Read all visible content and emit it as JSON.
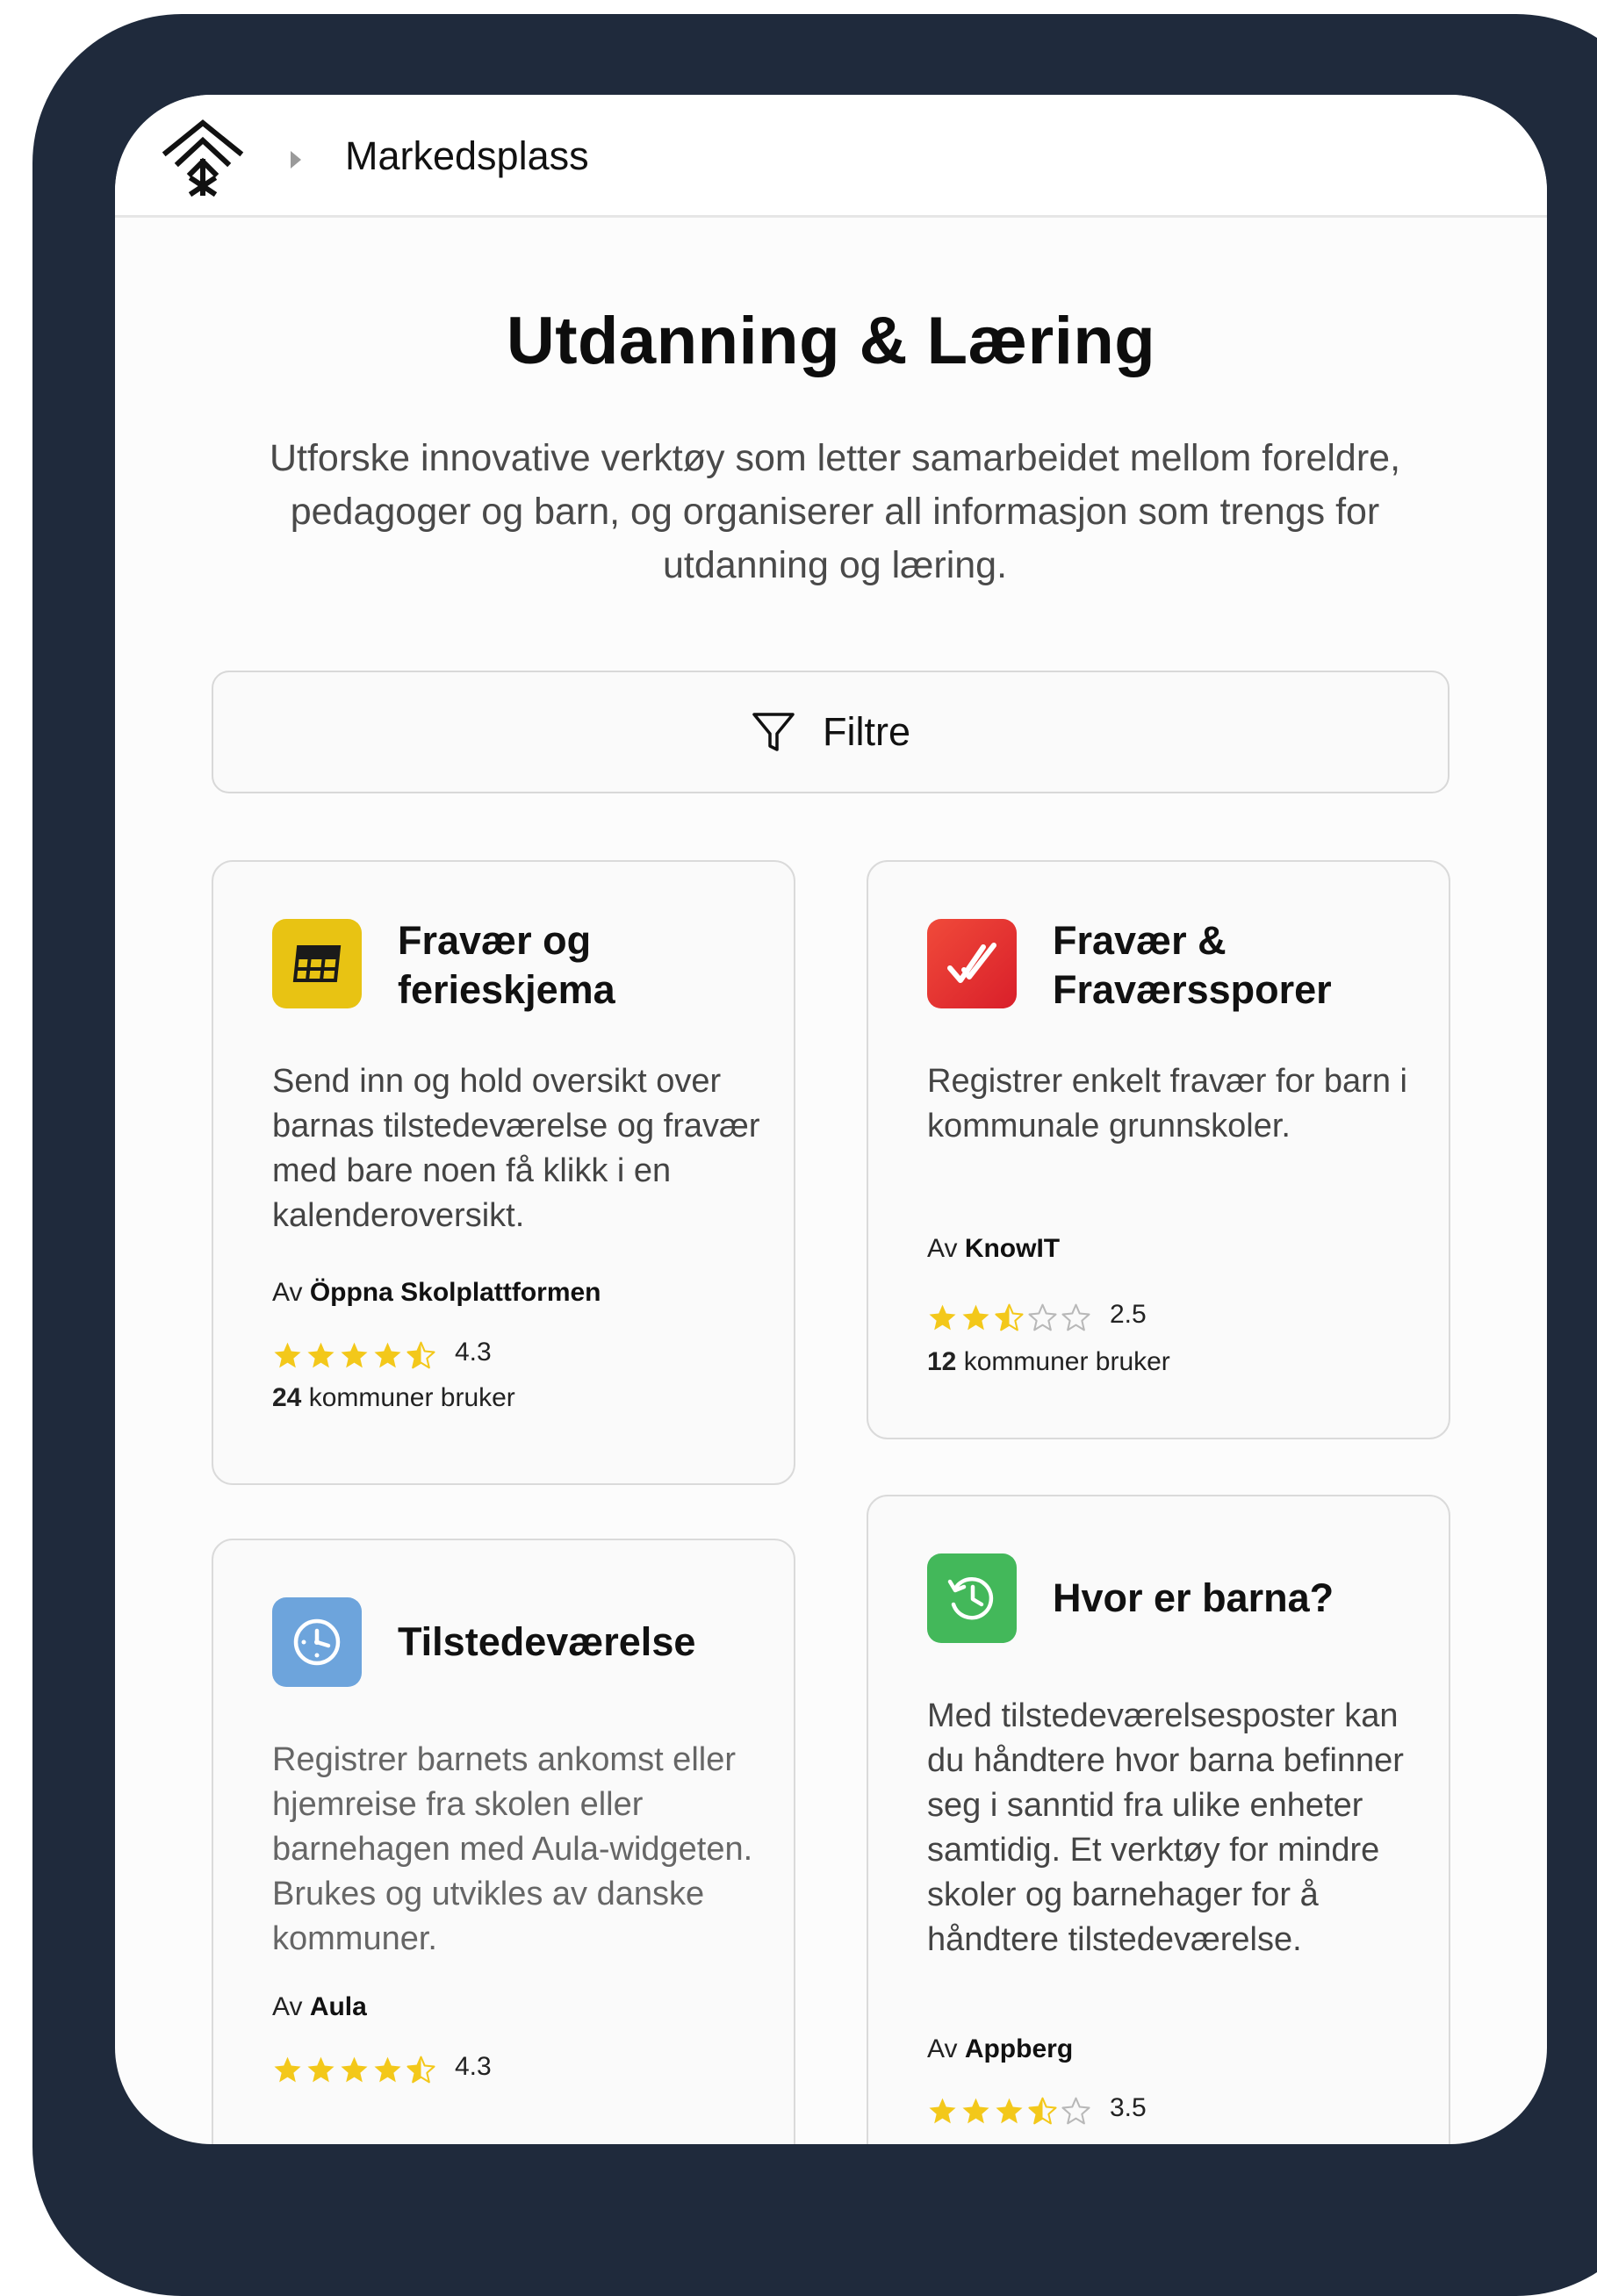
{
  "header": {
    "breadcrumb_title": "Markedsplass",
    "logo_icon": "diamond-tree-logo",
    "chevron_icon": "chevron-right-icon"
  },
  "page": {
    "title": "Utdanning & Læring",
    "description": "Utforske innovative verktøy som letter samarbeidet mellom foreldre, pedagoger og barn, og organiserer all informasjon som trengs for utdanning og læring."
  },
  "filters": {
    "label": "Filtre",
    "icon": "filter-icon"
  },
  "cards": [
    {
      "title": "Fravær og ferieskjema",
      "icon": "calendar-grid-icon",
      "icon_color": "#e8c313",
      "description": "Send inn og hold oversikt over barnas tilstedeværelse og fravær med bare noen få klikk i en kalenderoversikt.",
      "vendor_prefix": "Av",
      "vendor": "Öppna Skolplattformen",
      "rating": 4.3,
      "rating_label": "4.3",
      "usage_count": "24",
      "usage_text": "kommuner bruker"
    },
    {
      "title": "Fravær & Fraværssporer",
      "icon": "double-check-icon",
      "icon_color": "#e53935",
      "description": "Registrer enkelt fravær for barn i kommunale grunnskoler.",
      "vendor_prefix": "Av",
      "vendor": "KnowIT",
      "rating": 2.5,
      "rating_label": "2.5",
      "usage_count": "12",
      "usage_text": "kommuner bruker"
    },
    {
      "title": "Tilstedeværelse",
      "icon": "clock-icon",
      "icon_color": "#6da4dc",
      "description": "Registrer barnets ankomst eller hjemreise fra skolen eller barnehagen med Aula-widgeten. Brukes og utvikles av danske kommuner.",
      "vendor_prefix": "Av",
      "vendor": "Aula",
      "rating": 4.3,
      "rating_label": "4.3"
    },
    {
      "title": "Hvor er barna?",
      "icon": "history-clock-icon",
      "icon_color": "#43b85a",
      "description": "Med tilstedeværelsesposter kan du håndtere hvor barna befinner seg i sanntid fra ulike enheter samtidig. Et verktøy for mindre skoler og barnehager for å håndtere tilstedeværelse.",
      "vendor_prefix": "Av",
      "vendor": "Appberg",
      "rating": 3.5,
      "rating_label": "3.5"
    }
  ]
}
